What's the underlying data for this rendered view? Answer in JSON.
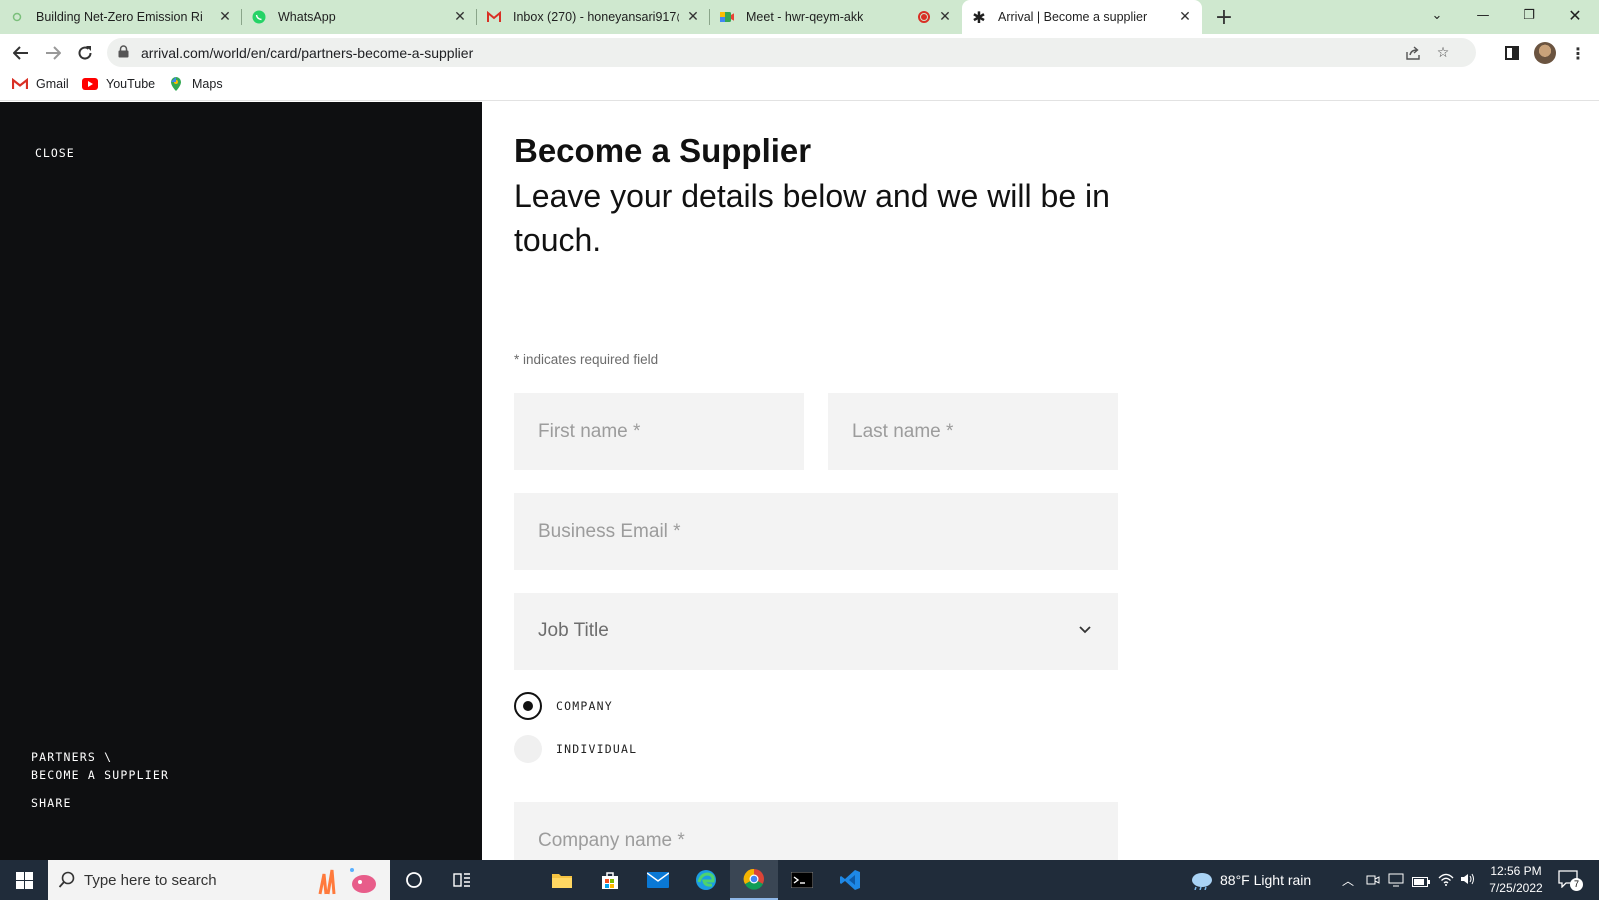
{
  "browser": {
    "tabs": [
      {
        "title": "Building Net-Zero Emission Ride:",
        "icon": "dot-icon"
      },
      {
        "title": "WhatsApp",
        "icon": "whatsapp-icon"
      },
      {
        "title": "Inbox (270) - honeyansari917@g",
        "icon": "gmail-icon"
      },
      {
        "title": "Meet - hwr-qeym-akk",
        "icon": "meet-icon"
      },
      {
        "title": "Arrival | Become a supplier",
        "icon": "asterisk-icon"
      }
    ],
    "url": "arrival.com/world/en/card/partners-become-a-supplier",
    "bookmarks": [
      {
        "label": "Gmail"
      },
      {
        "label": "YouTube"
      },
      {
        "label": "Maps"
      }
    ]
  },
  "sidebar": {
    "close_label": "CLOSE",
    "breadcrumb_line1": "PARTNERS \\",
    "breadcrumb_line2": "BECOME A SUPPLIER",
    "share_label": "SHARE"
  },
  "form": {
    "title": "Become a Supplier",
    "subtitle": "Leave your details below and we will be in touch.",
    "required_note": "* indicates required field",
    "first_name_placeholder": "First name *",
    "last_name_placeholder": "Last name *",
    "email_placeholder": "Business Email *",
    "job_title_label": "Job Title",
    "radio_company": "COMPANY",
    "radio_individual": "INDIVIDUAL",
    "radio_selected": "COMPANY",
    "company_name_placeholder": "Company name *"
  },
  "taskbar": {
    "search_placeholder": "Type here to search",
    "weather": "88°F  Light rain",
    "time": "12:56 PM",
    "date": "7/25/2022",
    "notification_count": "7"
  }
}
